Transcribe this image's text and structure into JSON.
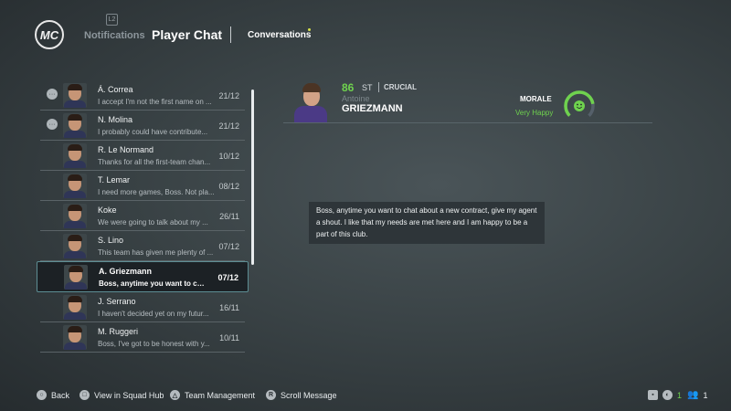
{
  "header": {
    "logo_text": "MC",
    "notifications_label": "Notifications",
    "notifications_badge": "L2",
    "title": "Player Chat",
    "conversations_label": "Conversations"
  },
  "conversations": [
    {
      "name": "Á. Correa",
      "preview": "I accept I'm not the first name on ...",
      "date": "21/12",
      "has_bubble": true
    },
    {
      "name": "N. Molina",
      "preview": "I probably could have contribute...",
      "date": "21/12",
      "has_bubble": true
    },
    {
      "name": "R. Le Normand",
      "preview": "Thanks for all the first-team chan...",
      "date": "10/12",
      "has_bubble": false
    },
    {
      "name": "T. Lemar",
      "preview": "I need more games, Boss. Not pla...",
      "date": "08/12",
      "has_bubble": false
    },
    {
      "name": "Koke",
      "preview": "We were going to talk about my ...",
      "date": "26/11",
      "has_bubble": false
    },
    {
      "name": "S. Lino",
      "preview": "This team has given me plenty of ...",
      "date": "07/12",
      "has_bubble": false
    },
    {
      "name": "A. Griezmann",
      "preview": "Boss, anytime you want to chat ...",
      "date": "07/12",
      "has_bubble": false,
      "selected": true
    },
    {
      "name": "J. Serrano",
      "preview": "I haven't decided yet on my futur...",
      "date": "16/11",
      "has_bubble": false
    },
    {
      "name": "M. Ruggeri",
      "preview": "Boss, I've got to be honest with y...",
      "date": "10/11",
      "has_bubble": false
    }
  ],
  "player": {
    "rating": "86",
    "position": "ST",
    "role": "CRUCIAL",
    "first_name": "Antoine",
    "last_name": "GRIEZMANN",
    "morale_label": "MORALE",
    "morale_value": "Very Happy",
    "morale_level": 0.8,
    "morale_color": "#6fd24e"
  },
  "message": {
    "text": "Boss, anytime you want to chat about a new contract, give my agent a shout. I like that my needs are met here and I am happy to be a part of this club."
  },
  "footer": {
    "back_label": "Back",
    "back_icon": "circle-button-icon",
    "squad_hub_label": "View in Squad Hub",
    "squad_hub_icon": "square-button-icon",
    "team_management_label": "Team Management",
    "team_management_icon": "triangle-button-icon",
    "scroll_label": "Scroll Message",
    "scroll_icon": "right-stick-icon",
    "status_count_1": "1",
    "status_count_2": "1"
  },
  "colors": {
    "accent_green": "#6fd24e",
    "selected_border": "#5d8e94",
    "background": "#3a4346"
  }
}
